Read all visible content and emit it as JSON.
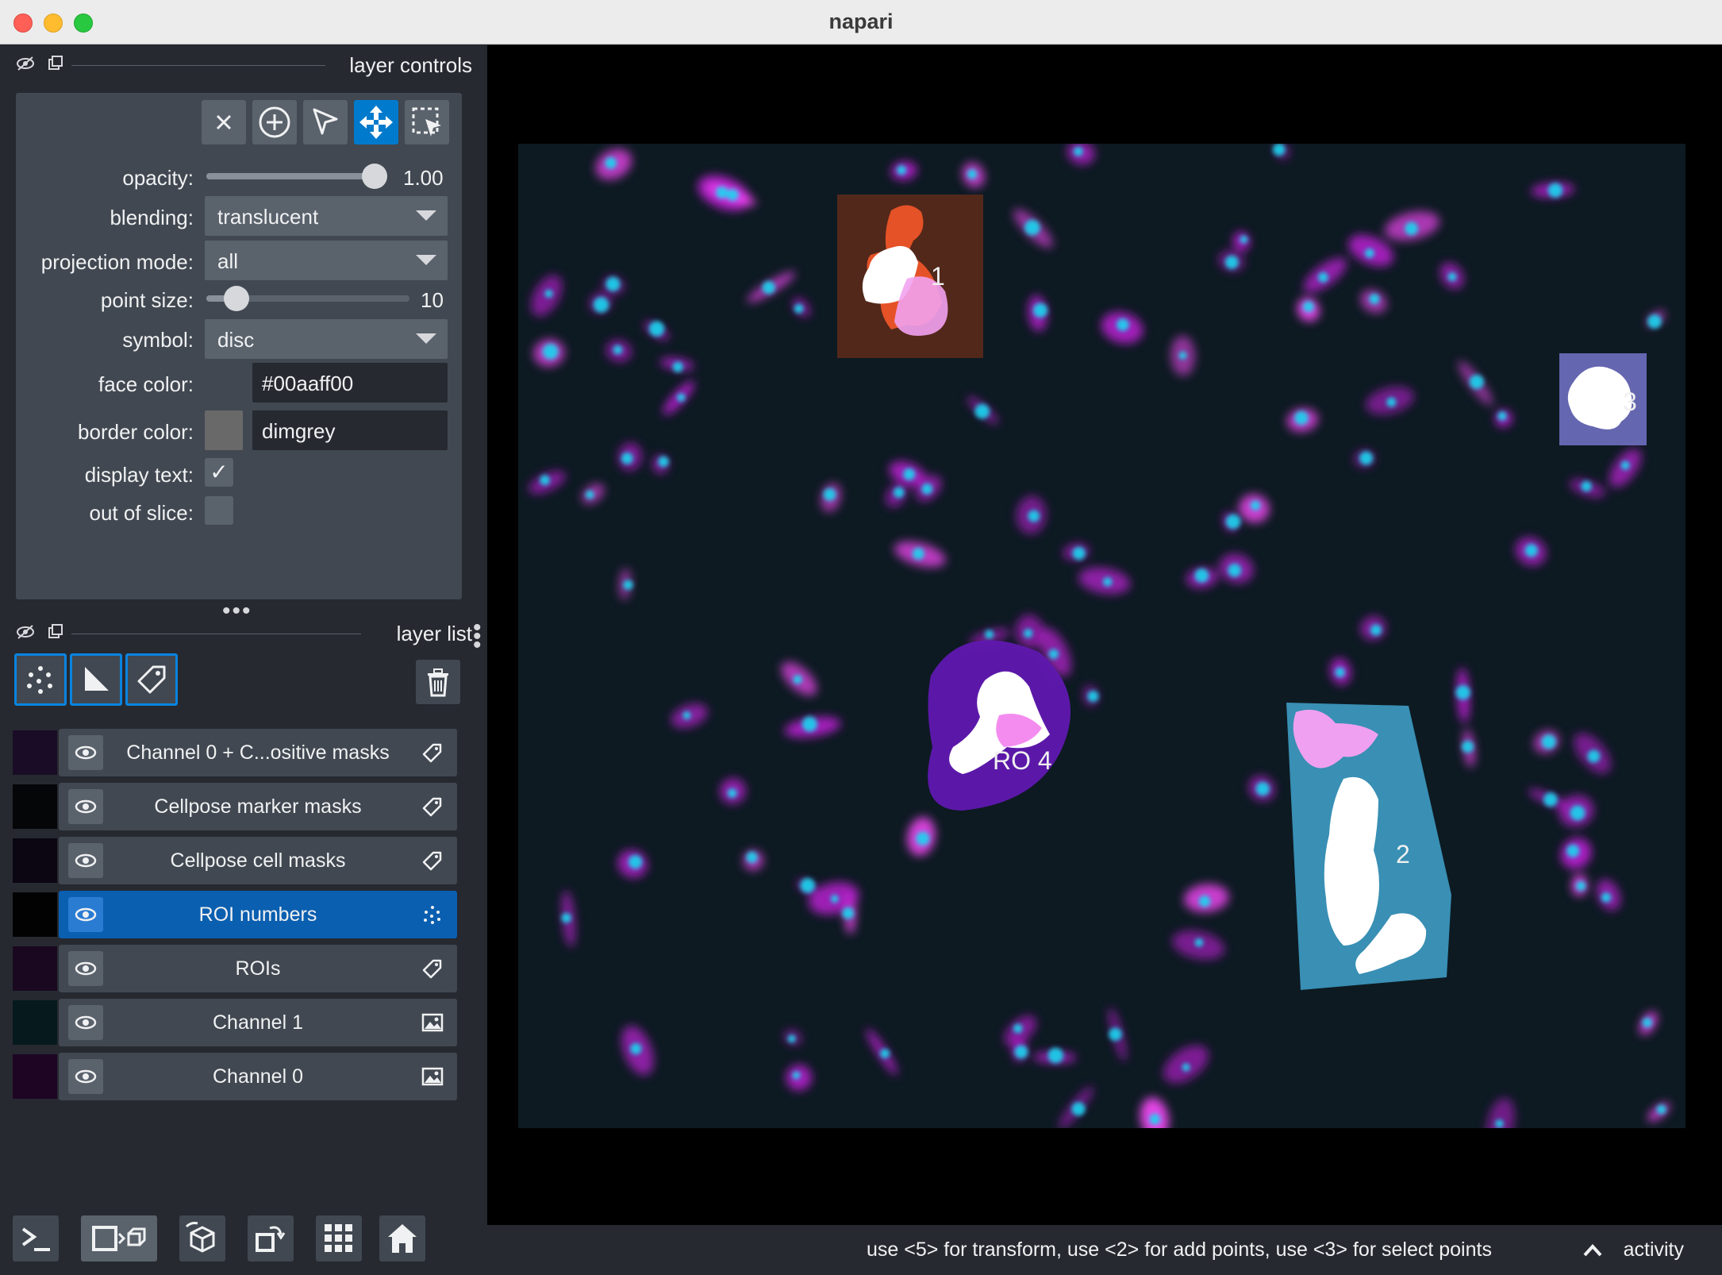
{
  "window": {
    "title": "napari"
  },
  "layer_controls": {
    "header": "layer controls",
    "opacity": {
      "label": "opacity:",
      "value": "1.00",
      "fraction": 1.0
    },
    "blending": {
      "label": "blending:",
      "value": "translucent"
    },
    "projection_mode": {
      "label": "projection mode:",
      "value": "all"
    },
    "point_size": {
      "label": "point size:",
      "value": "10",
      "fraction": 0.1
    },
    "symbol": {
      "label": "symbol:",
      "value": "disc"
    },
    "face_color": {
      "label": "face color:",
      "value": "#00aaff00",
      "swatch": "#414851"
    },
    "border_color": {
      "label": "border color:",
      "value": "dimgrey",
      "swatch": "#696969"
    },
    "display_text": {
      "label": "display text:",
      "checked": true,
      "mark": "✓"
    },
    "out_of_slice": {
      "label": "out of slice:",
      "checked": false
    }
  },
  "layer_list": {
    "header": "layer list",
    "layers": [
      {
        "name": "Channel 0 + C...ositive masks",
        "type": "labels",
        "selected": false
      },
      {
        "name": "Cellpose marker masks",
        "type": "labels",
        "selected": false
      },
      {
        "name": "Cellpose cell masks",
        "type": "labels",
        "selected": false
      },
      {
        "name": "ROI numbers",
        "type": "points",
        "selected": true
      },
      {
        "name": "ROIs",
        "type": "labels",
        "selected": false
      },
      {
        "name": "Channel 1",
        "type": "image",
        "selected": false
      },
      {
        "name": "Channel 0",
        "type": "image",
        "selected": false
      }
    ]
  },
  "canvas": {
    "roi_labels": [
      "1",
      "2",
      "3",
      "RO 4"
    ],
    "colors": {
      "roi1": "#5a2a1a",
      "roi2": "#3e9cc4",
      "roi3": "#6a6ab8",
      "roi4": "#6018b0"
    }
  },
  "status": {
    "message": "use <5> for transform, use <2> for add points, use <3> for select points",
    "activity": "activity"
  }
}
